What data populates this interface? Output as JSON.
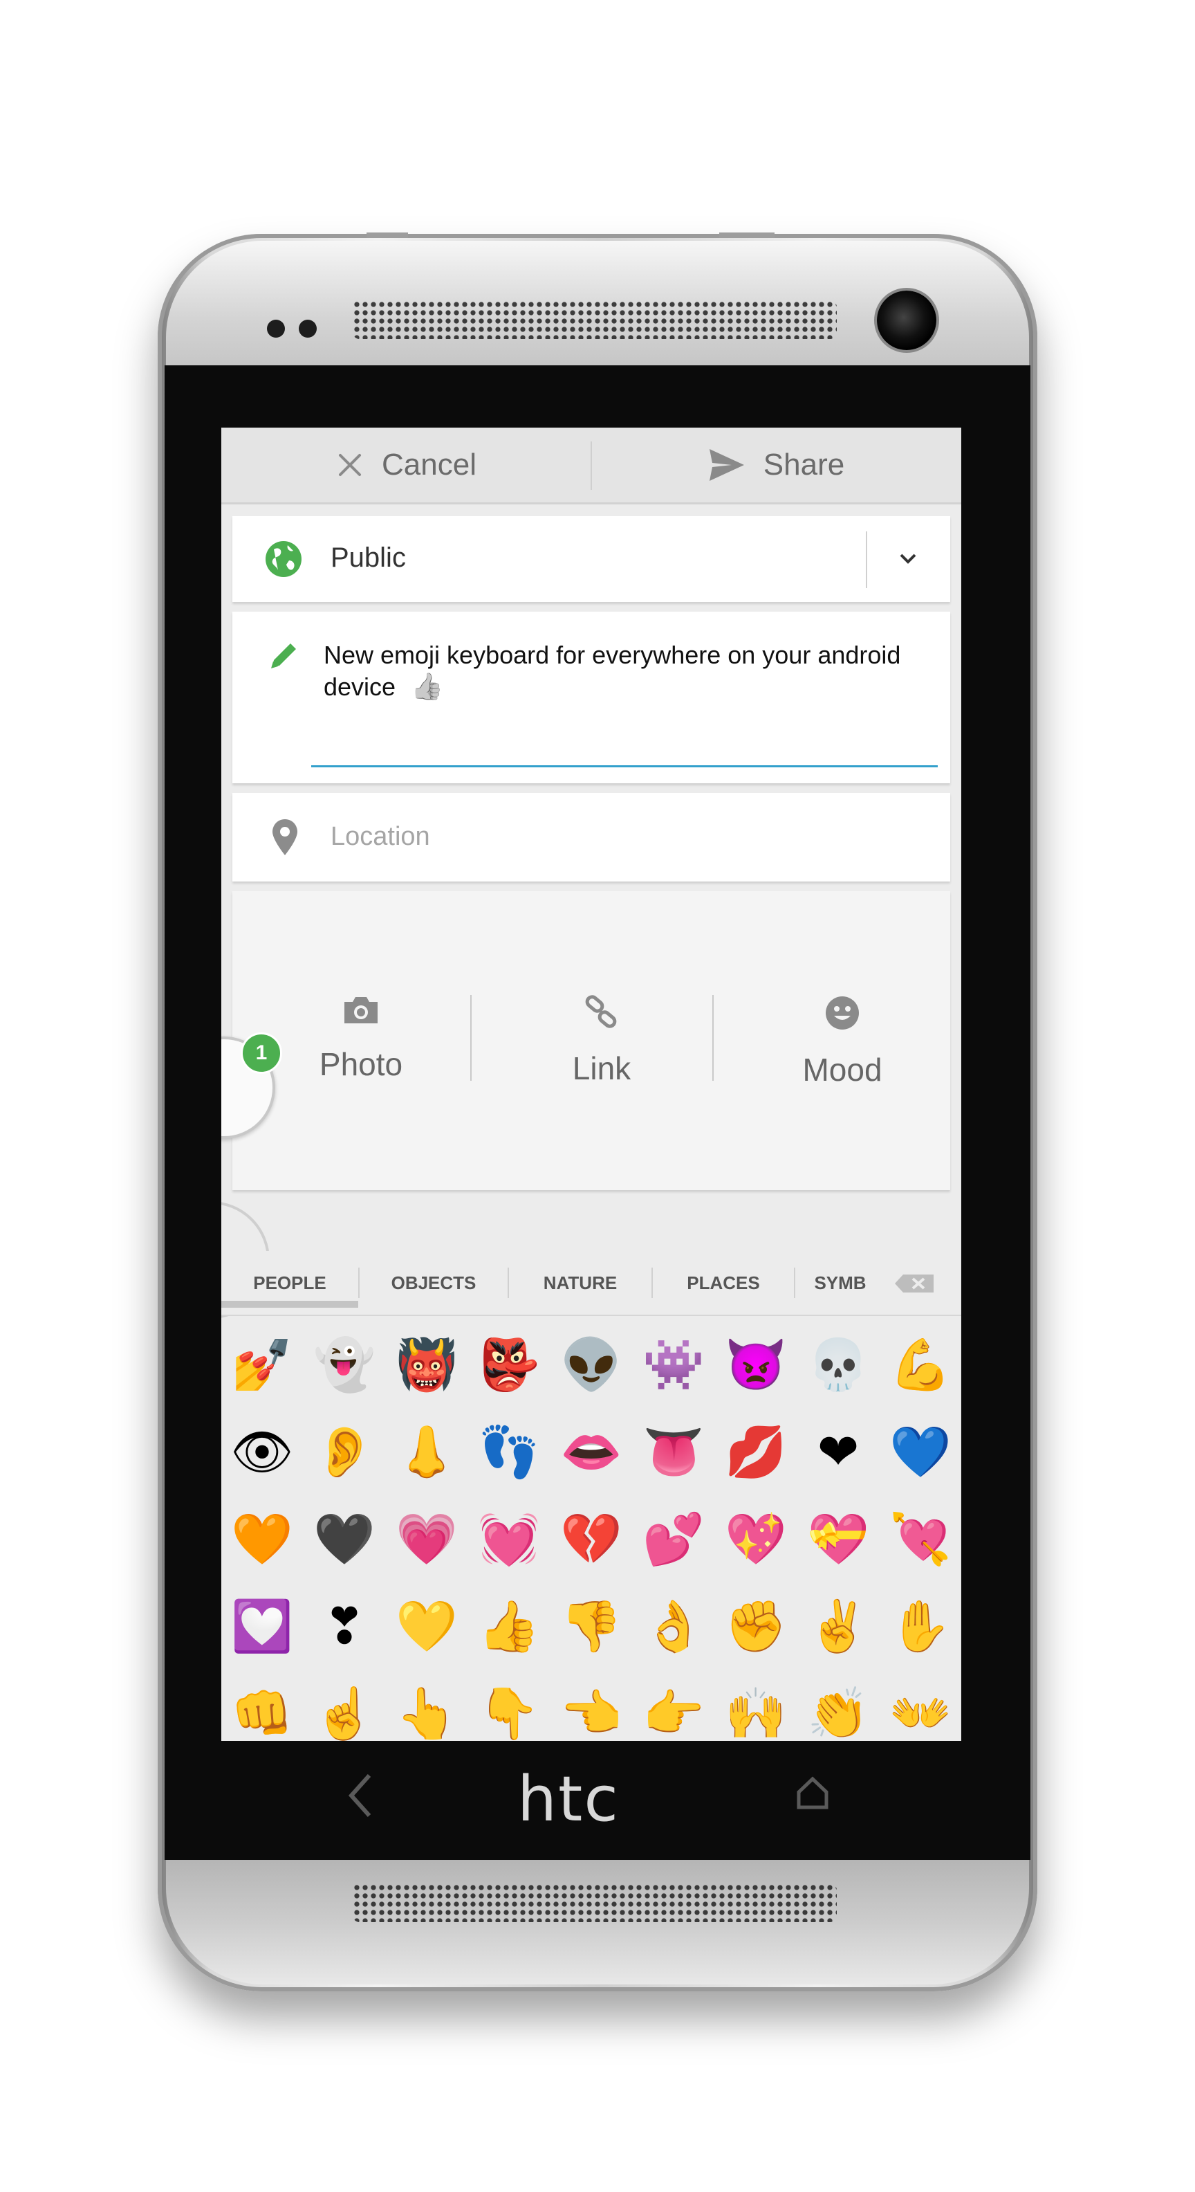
{
  "action_bar": {
    "cancel_label": "Cancel",
    "share_label": "Share",
    "cancel_icon": "close-icon",
    "share_icon": "send-icon"
  },
  "privacy": {
    "label": "Public",
    "icon": "globe-icon",
    "dropdown_icon": "chevron-down-icon"
  },
  "post": {
    "text": "New emoji keyboard for everywhere on your android device",
    "emoji": "👍",
    "icon": "pencil-icon"
  },
  "location": {
    "placeholder": "Location",
    "icon": "location-pin-icon"
  },
  "attachments": [
    {
      "label": "Photo",
      "icon": "camera-icon"
    },
    {
      "label": "Link",
      "icon": "link-icon"
    },
    {
      "label": "Mood",
      "icon": "smiley-icon"
    }
  ],
  "notification_badge": "1",
  "emoji_keyboard": {
    "tabs": [
      "PEOPLE",
      "OBJECTS",
      "NATURE",
      "PLACES",
      "SYMB"
    ],
    "active_tab": "PEOPLE",
    "delete_icon": "backspace-icon",
    "rows": [
      [
        "💅",
        "👻",
        "👹",
        "👺",
        "👽",
        "👾",
        "👿",
        "💀",
        "💪"
      ],
      [
        "👁",
        "👂",
        "👃",
        "👣",
        "👄",
        "👅",
        "💋",
        "❤",
        "💙"
      ],
      [
        "🧡",
        "🖤",
        "💗",
        "💓",
        "💔",
        "💕",
        "💖",
        "💝",
        "💘"
      ],
      [
        "💟",
        "❣",
        "💛",
        "👍",
        "👎",
        "👌",
        "✊",
        "✌",
        "✋"
      ],
      [
        "👊",
        "☝",
        "👆",
        "👇",
        "👈",
        "👉",
        "🙌",
        "👏",
        "👐"
      ]
    ]
  },
  "device": {
    "brand": "htc",
    "nav": [
      "back-icon",
      "home-icon"
    ]
  }
}
